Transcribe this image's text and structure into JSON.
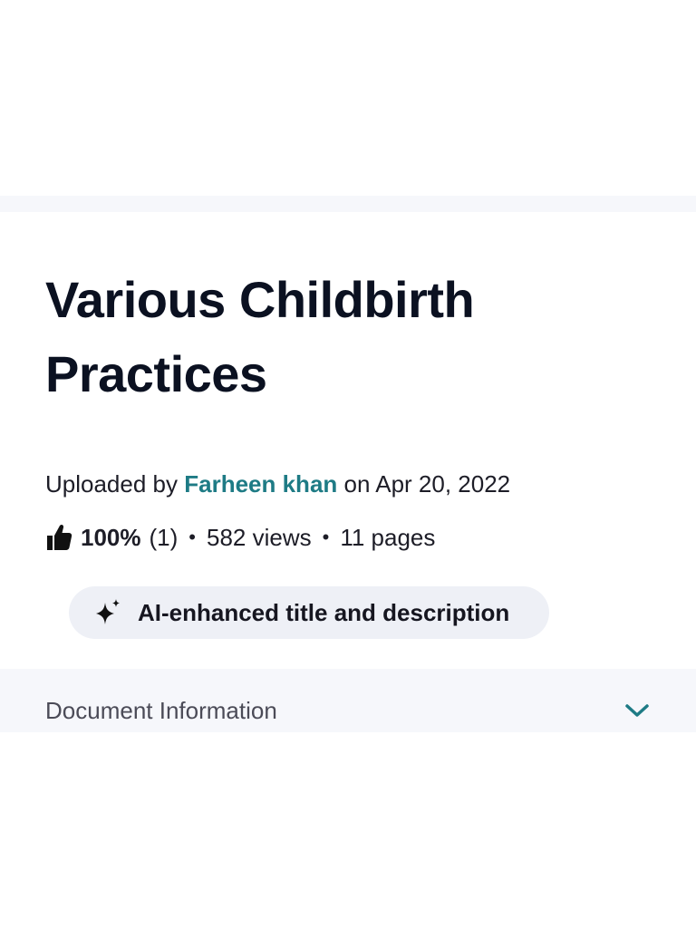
{
  "document": {
    "title": "Various Childbirth Practices",
    "uploaded_by_prefix": "Uploaded by",
    "author": "Farheen khan",
    "date_prefix": "on",
    "date": "Apr 20, 2022"
  },
  "stats": {
    "rating": "100%",
    "rating_count": "(1)",
    "separator": "•",
    "views": "582 views",
    "pages": "11 pages"
  },
  "ai_badge": {
    "label": "AI-enhanced title and description",
    "icon": "sparkle-icon"
  },
  "document_information": {
    "label": "Document Information",
    "icon": "chevron-down-icon"
  },
  "colors": {
    "accent": "#1e7b85",
    "pill_background": "#eef0f6",
    "section_background": "#f6f7fb",
    "title_text": "#0b1121"
  }
}
